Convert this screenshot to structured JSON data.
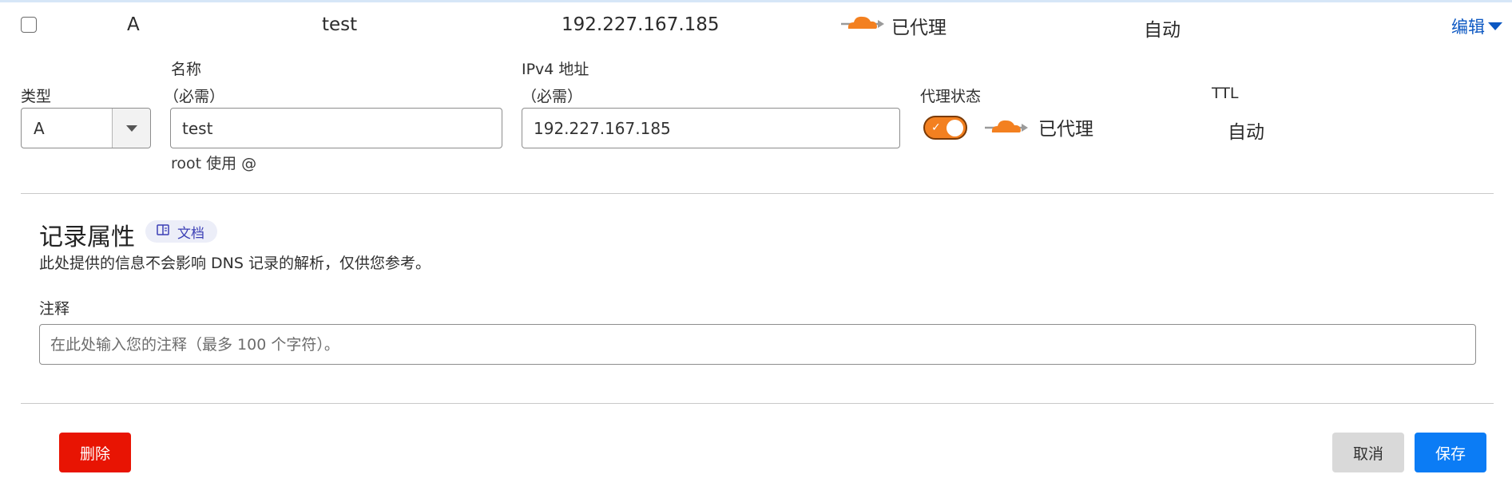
{
  "colors": {
    "accent_orange": "#f38020",
    "link_blue": "#0b57c2",
    "save_blue": "#0b7cf5",
    "delete_red": "#e81403",
    "docs_badge_bg": "#eceef8"
  },
  "record_row": {
    "type": "A",
    "name": "test",
    "content": "192.227.167.185",
    "proxy_status": "已代理",
    "proxy_icon": "cloud-proxied-icon",
    "ttl": "自动",
    "edit_label": "编辑",
    "edit_icon": "caret-down-icon"
  },
  "form": {
    "type_label": "类型",
    "type_value": "A",
    "type_dropdown_icon": "triangle-down-icon",
    "name_label": "名称",
    "name_required": "（必需）",
    "name_value": "test",
    "name_hint": "root 使用 @",
    "ipv4_label": "IPv4 地址",
    "ipv4_required": "（必需）",
    "ipv4_value": "192.227.167.185",
    "proxy_label": "代理状态",
    "proxy_toggle_on": true,
    "proxy_value": "已代理",
    "ttl_label": "TTL",
    "ttl_value": "自动"
  },
  "record_attributes": {
    "title": "记录属性",
    "docs_label": "文档",
    "docs_icon": "book-icon",
    "description": "此处提供的信息不会影响 DNS 记录的解析，仅供您参考。",
    "comment_label": "注释",
    "comment_placeholder": "在此处输入您的注释（最多 100 个字符）。",
    "comment_value": ""
  },
  "actions": {
    "delete_label": "删除",
    "cancel_label": "取消",
    "save_label": "保存"
  }
}
